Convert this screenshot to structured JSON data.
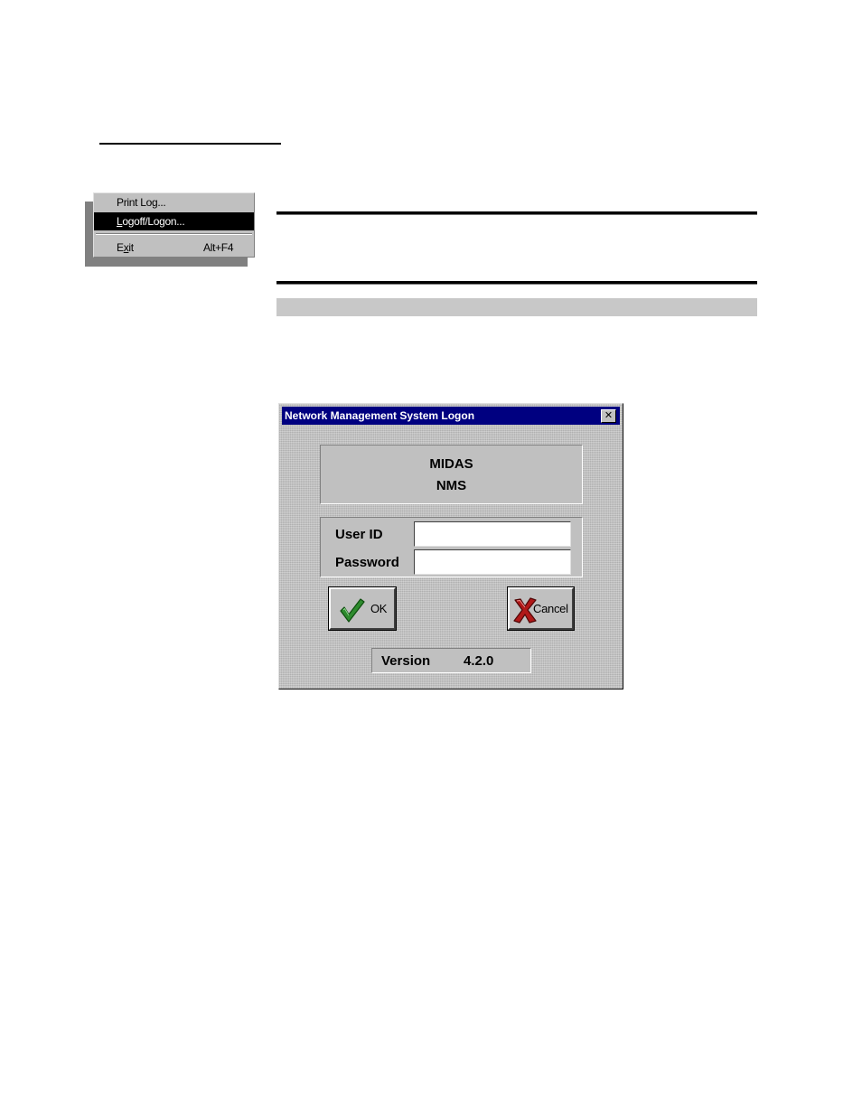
{
  "menu": {
    "items": [
      {
        "label": "Print Log...",
        "accelerator": ""
      },
      {
        "label_underlined": "L",
        "label_rest": "ogoff/Logon...",
        "label": "Logoff/Logon...",
        "accelerator": "",
        "highlighted": true
      },
      {
        "label_pre": "E",
        "label_underlined": "x",
        "label_rest": "it",
        "label": "Exit",
        "accelerator": "Alt+F4"
      }
    ]
  },
  "dialog": {
    "title": "Network Management System Logon",
    "close_glyph": "✕",
    "brand": {
      "line1": "MIDAS",
      "line2": "NMS"
    },
    "user_id_label": "User ID",
    "user_id_value": "",
    "password_label": "Password",
    "password_value": "",
    "ok_label": "OK",
    "cancel_label": "Cancel",
    "version_label": "Version",
    "version_value": "4.2.0"
  },
  "icons": {
    "ok": "check-icon",
    "cancel": "x-icon",
    "close": "close-icon"
  },
  "colors": {
    "titlebar": "#000080",
    "dialog_face": "#c0c0c0",
    "menu_highlight": "#000000",
    "ok_check": "#2e8b2e",
    "cancel_x": "#b01818"
  }
}
